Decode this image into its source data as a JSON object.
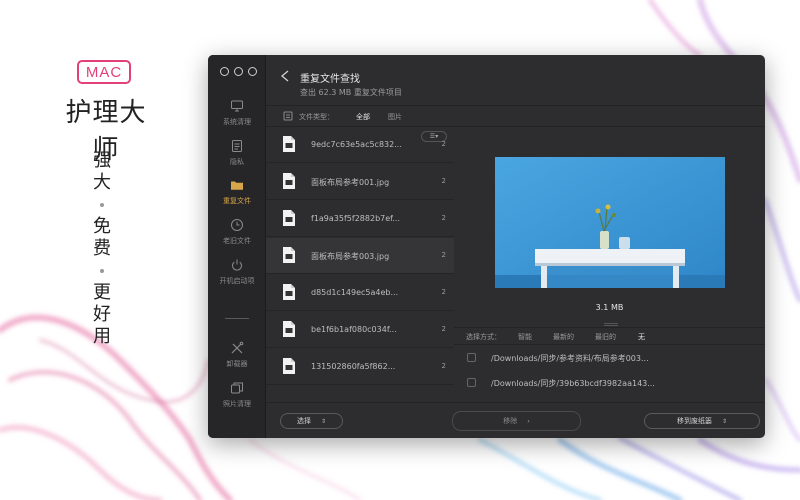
{
  "promo": {
    "badge": "MAC",
    "title": "护理大师",
    "slogan": [
      "强",
      "大",
      "免",
      "费",
      "更",
      "好",
      "用"
    ]
  },
  "sidebar": {
    "items": [
      {
        "label": "系统清理",
        "icon": "monitor-icon"
      },
      {
        "label": "隐私",
        "icon": "privacy-icon"
      },
      {
        "label": "重复文件",
        "icon": "folder-icon"
      },
      {
        "label": "老旧文件",
        "icon": "clock-icon"
      },
      {
        "label": "开机启动项",
        "icon": "power-icon"
      },
      {
        "label": "卸载器",
        "icon": "tools-icon"
      },
      {
        "label": "照片清理",
        "icon": "photos-icon"
      }
    ],
    "active_index": 2
  },
  "header": {
    "title": "重复文件查找",
    "subtitle": "查出 62.3 MB 重复文件项目"
  },
  "filter": {
    "label": "文件类型：",
    "options": [
      "全部",
      "图片"
    ],
    "selected": "全部"
  },
  "files": [
    {
      "name": "9edc7c63e5ac5c832...",
      "count": "2"
    },
    {
      "name": "面板布局参考001.jpg",
      "count": "2"
    },
    {
      "name": "f1a9a35f5f2882b7ef...",
      "count": "2"
    },
    {
      "name": "面板布局参考003.jpg",
      "count": "2"
    },
    {
      "name": "d85d1c149ec5a4eb...",
      "count": "2"
    },
    {
      "name": "be1f6b1af080c034f...",
      "count": "2"
    },
    {
      "name": "131502860fa5f862...",
      "count": "2"
    }
  ],
  "selected_file_index": 3,
  "preview": {
    "size": "3.1 MB",
    "select_label": "选择方式：",
    "select_options": [
      "智能",
      "最新的",
      "最旧的",
      "无"
    ],
    "selected_option": "无",
    "paths": [
      "/Downloads/同步/参考资料/布局参考003...",
      "/Downloads/同步/39b63bcdf3982aa143..."
    ]
  },
  "footer": {
    "select_label": "选择",
    "remove_label": "移除",
    "trash_label": "移到废纸篓"
  },
  "colors": {
    "accent": "#d8a64a",
    "brand": "#e2407a",
    "window_bg": "#2d2d30"
  }
}
